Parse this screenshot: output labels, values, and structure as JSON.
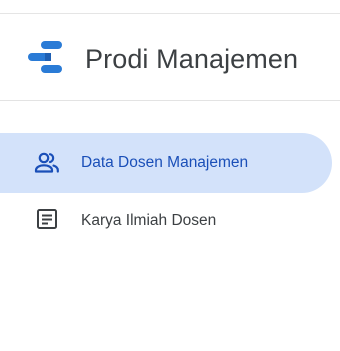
{
  "header": {
    "title": "Prodi Manajemen"
  },
  "colors": {
    "logo_blue": "#2a7bd6",
    "active_bg": "#d3e2fa",
    "active_text": "#1a4fb8",
    "text": "#3c4043"
  },
  "nav": {
    "items": [
      {
        "label": "Data Dosen Manajemen",
        "icon": "people-icon",
        "active": true
      },
      {
        "label": "Karya Ilmiah Dosen",
        "icon": "document-icon",
        "active": false
      }
    ]
  }
}
